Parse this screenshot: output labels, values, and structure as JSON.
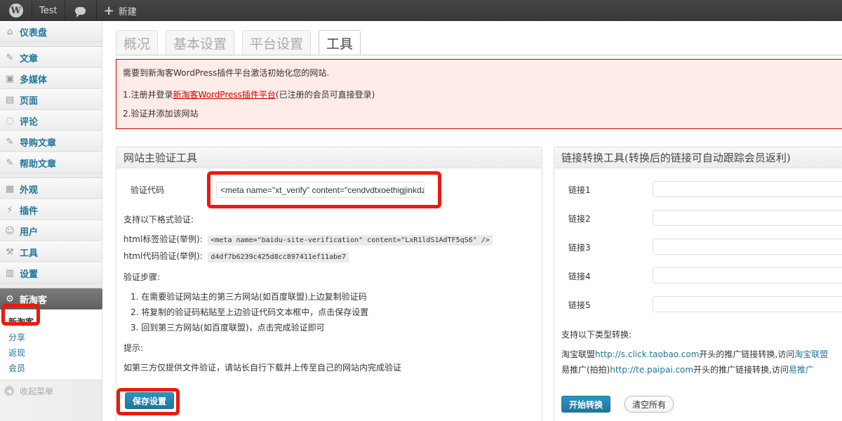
{
  "adminbar": {
    "site_name": "Test",
    "new_label": "新建"
  },
  "sidebar": {
    "items": [
      {
        "label": "仪表盘",
        "icon": "dashboard-icon"
      },
      {
        "label": "文章",
        "icon": "pin-icon"
      },
      {
        "label": "多媒体",
        "icon": "media-icon"
      },
      {
        "label": "页面",
        "icon": "page-icon"
      },
      {
        "label": "评论",
        "icon": "comment-icon"
      },
      {
        "label": "导购文章",
        "icon": "pin-icon"
      },
      {
        "label": "帮助文章",
        "icon": "pin-icon"
      },
      {
        "label": "外观",
        "icon": "appearance-icon"
      },
      {
        "label": "插件",
        "icon": "plugin-icon"
      },
      {
        "label": "用户",
        "icon": "users-icon"
      },
      {
        "label": "工具",
        "icon": "tools-icon"
      },
      {
        "label": "设置",
        "icon": "settings-icon"
      }
    ],
    "current": {
      "label": "新淘客",
      "icon": "gear-icon"
    },
    "submenu": [
      "新淘客",
      "分享",
      "返现",
      "会员"
    ],
    "collapse_label": "收起菜单"
  },
  "tabs": [
    "概况",
    "基本设置",
    "平台设置",
    "工具"
  ],
  "notice": {
    "heading": "需要到新淘客WordPress插件平台激活初始化您的网站.",
    "step1_prefix": "1.注册并登录",
    "step1_link": "新淘客WordPress插件平台",
    "step1_suffix": "(已注册的会员可直接登录)",
    "step2": "2.验证并添加该网站"
  },
  "verify_panel": {
    "title": "网站主验证工具",
    "code_label": "验证代码",
    "code_value": "<meta name=\"xt_verify\" content=\"cendvdtxoethigjinkdz",
    "formats_label": "支持以下格式验证:",
    "html_tag_label": "html标签验证(举例):",
    "html_tag_example": "<meta name=\"baidu-site-verification\" content=\"LxR1ldS1AdTF5qS6\" />",
    "html_code_label": "html代码验证(举例):",
    "html_code_example": "d4df7b6239c425d8cc897411ef11abe7",
    "steps_label": "验证步骤:",
    "steps": [
      "1. 在需要验证网站主的第三方网站(如百度联盟)上边复制验证码",
      "2. 将复制的验证码粘贴至上边验证代码文本框中，点击保存设置",
      "3. 回到第三方网站(如百度联盟)，点击完成验证即可"
    ],
    "hint_label": "提示:",
    "hint_text": "如第三方仅提供文件验证，请站长自行下载并上传至自己的网站内完成验证",
    "save_button": "保存设置"
  },
  "convert_panel": {
    "title": "链接转换工具(转换后的链接可自动跟踪会员返利)",
    "links": [
      "链接1",
      "链接2",
      "链接3",
      "链接4",
      "链接5"
    ],
    "support_label": "支持以下类型转换:",
    "taobao_prefix": "淘宝联盟",
    "taobao_url": "http://s.click.taobao.com",
    "taobao_mid": "开头的推广链接转换,访问",
    "taobao_link": "淘宝联盟",
    "paipai_prefix": "易推广(拍拍)",
    "paipai_url": "http://te.paipai.com",
    "paipai_mid": "开头的推广链接转换,访问",
    "paipai_link": "易推广",
    "start_button": "开始转换",
    "clear_button": "清空所有"
  }
}
